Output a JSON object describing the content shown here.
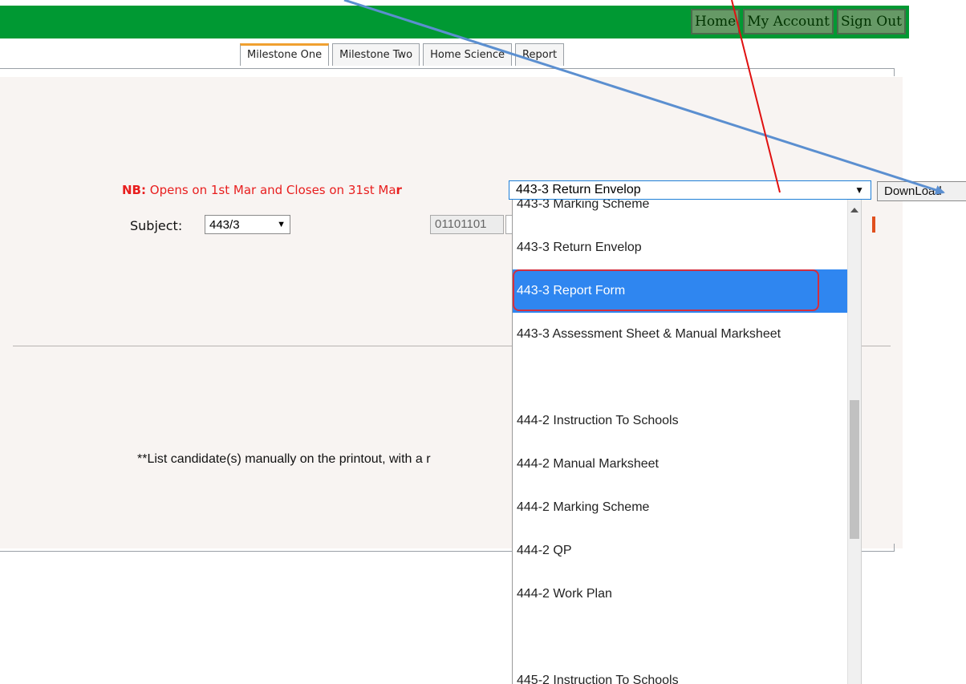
{
  "topnav": {
    "items": [
      "Home",
      "My Account",
      "Sign Out"
    ]
  },
  "tabs": [
    "Milestone One",
    "Milestone Two",
    "Home Science",
    "Report"
  ],
  "notice": {
    "prefix": "NB:",
    "text": " Opens on 1st Mar and Closes on 31st Ma",
    "suffix": "r"
  },
  "document_select": {
    "value": "443-3 Return Envelop"
  },
  "download_label": "DownLoad",
  "subject": {
    "label": "Subject:",
    "value": "443/3"
  },
  "center_number": "01101101",
  "list_note": "**List candidate(s) manually on the printout, with a r",
  "dropdown": {
    "selected_index": 2,
    "items": [
      "443-3 Marking Scheme",
      "443-3 Return Envelop",
      "443-3 Report Form",
      "443-3 Assessment Sheet & Manual Marksheet",
      "",
      "444-2 Instruction To Schools",
      "444-2 Manual Marksheet",
      "444-2 Marking Scheme",
      "444-2 QP",
      "444-2 Work Plan",
      "",
      "445-2 Instruction To Schools"
    ]
  },
  "colors": {
    "topbar": "#009933",
    "notice": "#e81e1e",
    "selected_item": "#2f86f0",
    "highlight_box": "#d32f3f",
    "red_arrow": "#e01010",
    "blue_arrow": "#5b8fd0"
  }
}
